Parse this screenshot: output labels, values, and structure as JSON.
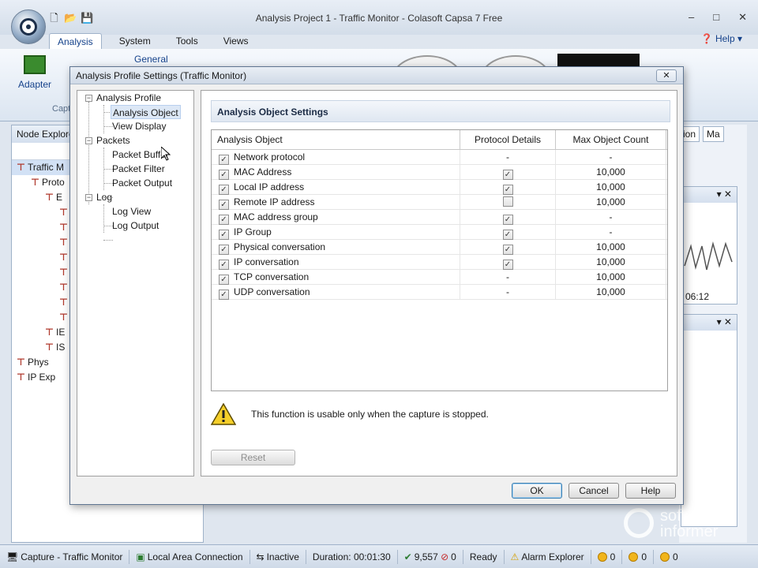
{
  "window": {
    "title": "Analysis Project 1 - Traffic Monitor - Colasoft Capsa 7 Free",
    "minimize": "–",
    "maximize": "□",
    "close": "✕"
  },
  "ribbon": {
    "tabs": [
      "Analysis",
      "System",
      "Tools",
      "Views"
    ],
    "active_tab": "Analysis",
    "help_label": "Help",
    "adapter_label": "Adapter",
    "general_label": "General",
    "group_label": "Capt"
  },
  "node_explorer": {
    "title": "Node Explore",
    "rows": [
      {
        "indent": 0,
        "label": "Traffic M",
        "selected": true
      },
      {
        "indent": 1,
        "label": "Proto",
        "selected": false
      },
      {
        "indent": 2,
        "label": "E",
        "selected": false
      },
      {
        "indent": 3,
        "label": "",
        "selected": false
      },
      {
        "indent": 3,
        "label": "",
        "selected": false
      },
      {
        "indent": 3,
        "label": "",
        "selected": false
      },
      {
        "indent": 3,
        "label": "",
        "selected": false
      },
      {
        "indent": 3,
        "label": "",
        "selected": false
      },
      {
        "indent": 3,
        "label": "",
        "selected": false
      },
      {
        "indent": 3,
        "label": "",
        "selected": false
      },
      {
        "indent": 3,
        "label": "",
        "selected": false
      },
      {
        "indent": 2,
        "label": "IE",
        "selected": false
      },
      {
        "indent": 2,
        "label": "IS",
        "selected": false
      },
      {
        "indent": 0,
        "label": "Phys",
        "selected": false
      },
      {
        "indent": 0,
        "label": "IP Exp",
        "selected": false
      }
    ]
  },
  "right_tabs": [
    "ion",
    "Ma"
  ],
  "chart_time": "06:12",
  "dialog": {
    "title": "Analysis Profile Settings (Traffic Monitor)",
    "close": "✕",
    "tree": [
      {
        "label": "Analysis Profile",
        "level": 0,
        "expand": "−"
      },
      {
        "label": "Analysis Object",
        "level": 1,
        "selected": true
      },
      {
        "label": "View Display",
        "level": 1
      },
      {
        "label": "Packets",
        "level": 0,
        "expand": "−"
      },
      {
        "label": "Packet Buffer",
        "level": 1
      },
      {
        "label": "Packet Filter",
        "level": 1
      },
      {
        "label": "Packet Output",
        "level": 1
      },
      {
        "label": "Log",
        "level": 0,
        "expand": "−"
      },
      {
        "label": "Log View",
        "level": 1
      },
      {
        "label": "Log Output",
        "level": 1
      }
    ],
    "section_title": "Analysis Object Settings",
    "grid": {
      "headers": [
        "Analysis Object",
        "Protocol Details",
        "Max Object Count"
      ],
      "rows": [
        {
          "name": "Network protocol",
          "enabled": true,
          "details": "-",
          "max": "-"
        },
        {
          "name": "MAC Address",
          "enabled": true,
          "details": "checked",
          "max": "10,000"
        },
        {
          "name": "Local IP address",
          "enabled": true,
          "details": "checked",
          "max": "10,000"
        },
        {
          "name": "Remote IP address",
          "enabled": true,
          "details": "unchecked",
          "max": "10,000"
        },
        {
          "name": "MAC address group",
          "enabled": true,
          "details": "checked",
          "max": "-"
        },
        {
          "name": "IP Group",
          "enabled": true,
          "details": "checked",
          "max": "-"
        },
        {
          "name": "Physical conversation",
          "enabled": true,
          "details": "checked",
          "max": "10,000"
        },
        {
          "name": "IP conversation",
          "enabled": true,
          "details": "checked",
          "max": "10,000"
        },
        {
          "name": "TCP conversation",
          "enabled": true,
          "details": "-",
          "max": "10,000"
        },
        {
          "name": "UDP conversation",
          "enabled": true,
          "details": "-",
          "max": "10,000"
        }
      ]
    },
    "warning_text": "This function is usable only when the capture is stopped.",
    "reset_label": "Reset",
    "ok_label": "OK",
    "cancel_label": "Cancel",
    "help_label": "Help"
  },
  "status_bar": {
    "capture": "Capture - Traffic Monitor",
    "connection": "Local Area Connection",
    "state": "Inactive",
    "duration": "Duration: 00:01:30",
    "packets": "9,557",
    "dropped": "0",
    "ready": "Ready",
    "alarm": "Alarm Explorer",
    "alarm_counts": [
      "0",
      "0",
      "0"
    ]
  },
  "watermark": {
    "line1": "software",
    "line2": "informer"
  },
  "colors": {
    "accent": "#15428b",
    "selection": "#dde8f6",
    "warning": "#f1c40f"
  }
}
